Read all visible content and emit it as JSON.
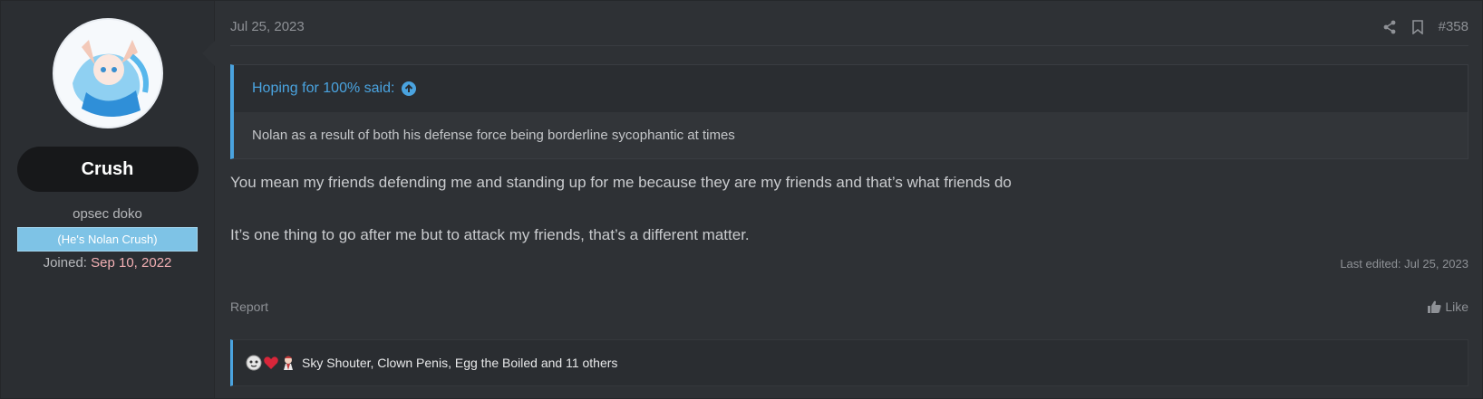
{
  "user": {
    "name": "Crush",
    "title": "opsec doko",
    "banner": "(He's Nolan Crush)",
    "joined_label": "Joined:",
    "joined_date": "Sep 10, 2022"
  },
  "post": {
    "date": "Jul 25, 2023",
    "number": "#358",
    "quote": {
      "title": "Hoping for 100% said:",
      "body": "Nolan as a result of both his defense force being borderline sycophantic at times"
    },
    "message": [
      "You mean my friends defending me and standing up for me because they are my friends and that’s what friends do",
      "It’s one thing to go after me but to attack my friends, that’s a different matter."
    ],
    "last_edited": "Last edited: Jul 25, 2023",
    "report_label": "Report",
    "like_label": "Like",
    "reactions_text": "Sky Shouter, Clown Penis, Egg the Boiled and 11 others"
  },
  "colors": {
    "accent": "#4aa3df",
    "joined_date": "#f3b0b4",
    "banner_bg": "#7ec3e6"
  }
}
